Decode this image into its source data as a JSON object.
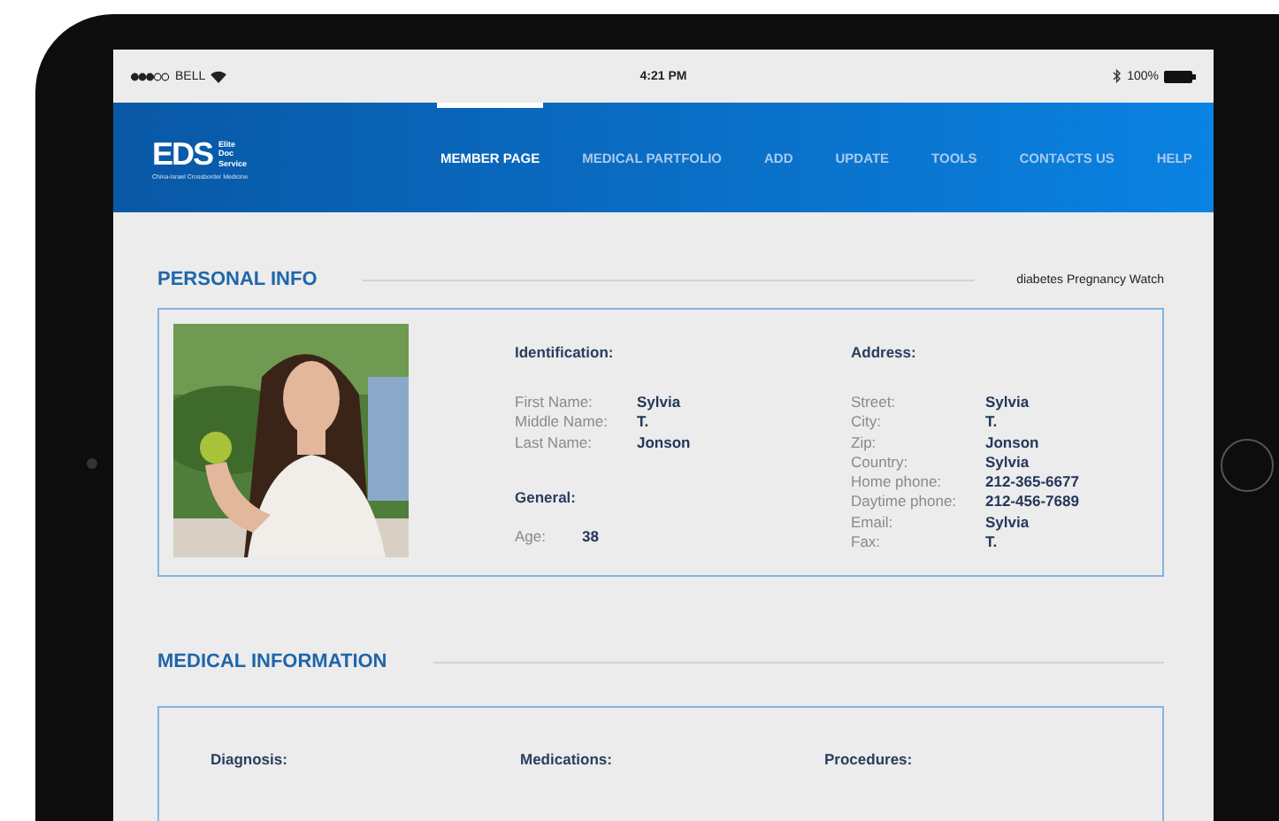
{
  "status_bar": {
    "carrier": "BELL",
    "time": "4:21 PM",
    "battery": "100%"
  },
  "nav": {
    "logo": {
      "mark": "EDS",
      "name": [
        "Elite",
        "Doc",
        "Service"
      ],
      "tagline": "China-Israel Crossborder Medicine"
    },
    "items": [
      {
        "label": "MEMBER PAGE",
        "selected": true
      },
      {
        "label": "MEDICAL PARTFOLIO",
        "selected": false
      },
      {
        "label": "ADD",
        "selected": false
      },
      {
        "label": "UPDATE",
        "selected": false
      },
      {
        "label": "TOOLS",
        "selected": false
      },
      {
        "label": "CONTACTS US",
        "selected": false
      },
      {
        "label": "HELP",
        "selected": false
      }
    ]
  },
  "personal_info": {
    "title": "PERSONAL INFO",
    "note": "diabetes Pregnancy Watch",
    "identification": {
      "heading": "Identification:",
      "fields": [
        {
          "label": "First Name:",
          "value": "Sylvia"
        },
        {
          "label": "Middle Name:",
          "value": "T."
        },
        {
          "label": "Last Name:",
          "value": "Jonson"
        }
      ]
    },
    "general": {
      "heading": "General:",
      "fields": [
        {
          "label": "Age:",
          "value": "38"
        }
      ]
    },
    "address": {
      "heading": "Address:",
      "fields": [
        {
          "label": "Street:",
          "value": "Sylvia"
        },
        {
          "label": "City:",
          "value": "T."
        },
        {
          "label": "Zip:",
          "value": "Jonson"
        },
        {
          "label": "Country:",
          "value": "Sylvia"
        },
        {
          "label": "Home phone:",
          "value": "212-365-6677"
        },
        {
          "label": "Daytime phone:",
          "value": "212-456-7689"
        },
        {
          "label": "Email:",
          "value": "Sylvia"
        },
        {
          "label": "Fax:",
          "value": "T."
        }
      ]
    }
  },
  "medical_information": {
    "title": "MEDICAL INFORMATION",
    "columns": [
      "Diagnosis:",
      "Medications:",
      "Procedures:"
    ]
  }
}
